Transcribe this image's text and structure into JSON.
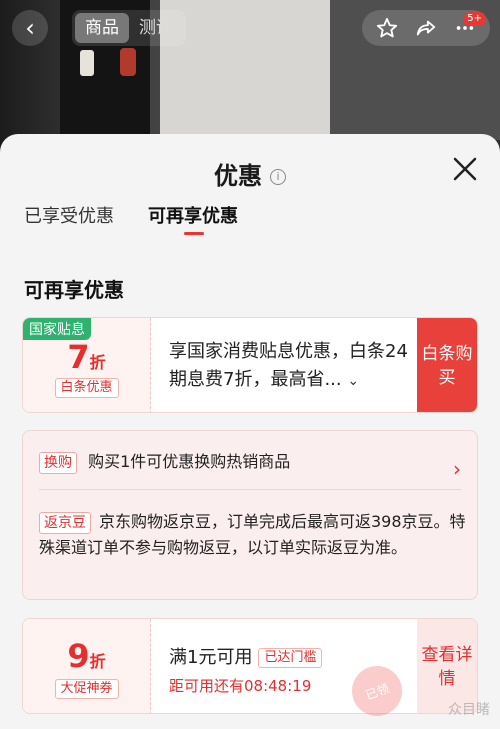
{
  "topbar": {
    "tabs": [
      "商品",
      "测评"
    ],
    "badge": "5+"
  },
  "sheet": {
    "title": "优惠",
    "tabs": [
      "已享受优惠",
      "可再享优惠"
    ],
    "section_title": "可再享优惠"
  },
  "coupon1": {
    "tag": "国家贴息",
    "discount_num": "7",
    "discount_unit": "折",
    "pill": "白条优惠",
    "desc": "享国家消费贴息优惠，白条24期息费7折，最高省...",
    "button": "白条购买"
  },
  "promo": {
    "trade_in_tag": "换购",
    "trade_in_text": "购买1件可优惠换购热销商品",
    "bean_tag": "返京豆",
    "bean_text": "京东购物返京豆，订单完成后最高可返398京豆。特殊渠道订单不参与购物返豆，以订单实际返豆为准。"
  },
  "coupon2": {
    "discount_num": "9",
    "discount_unit": "折",
    "pill": "大促神券",
    "title": "满1元可用",
    "reached": "已达门槛",
    "countdown": "距可用还有08:48:19",
    "button": "查看详情",
    "stamp": "已领"
  },
  "watermark": "众目睹",
  "colors": {
    "accent": "#e8403a",
    "green": "#2fb170"
  }
}
